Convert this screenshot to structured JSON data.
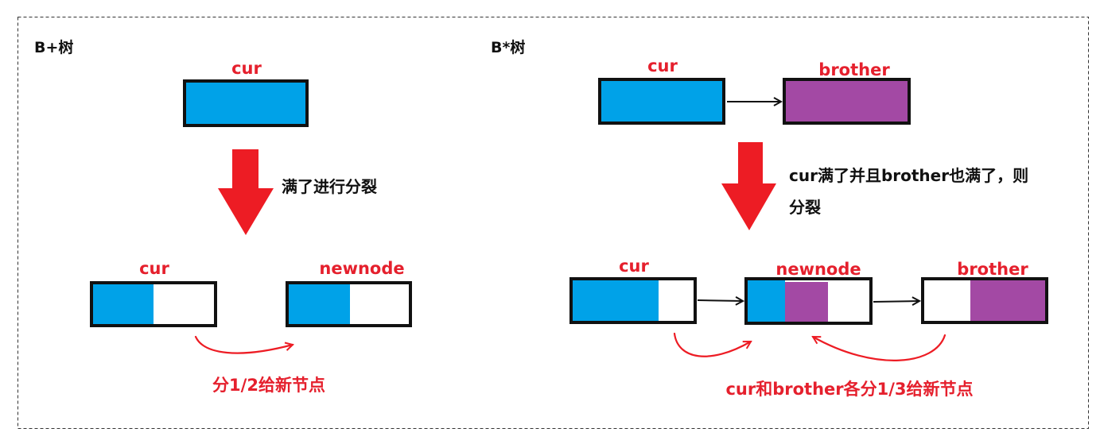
{
  "colors": {
    "cur_fill": "#00a2e8",
    "brother_fill": "#a349a4",
    "empty_fill": "#ffffff",
    "label_red": "#e5202d",
    "split_arrow": "#ed1c24",
    "border": "#111111"
  },
  "left_panel": {
    "title": "B+树",
    "top_cur_label": "cur",
    "split_caption": "满了进行分裂",
    "bottom_cur_label": "cur",
    "bottom_newnode_label": "newnode",
    "transfer_caption": "分1/2给新节点"
  },
  "right_panel": {
    "title": "B*树",
    "top_cur_label": "cur",
    "top_brother_label": "brother",
    "split_caption_line1": "cur满了并且brother也满了，则",
    "split_caption_line2": "分裂",
    "bottom_cur_label": "cur",
    "bottom_newnode_label": "newnode",
    "bottom_brother_label": "brother",
    "transfer_caption": "cur和brother各分1/3给新节点"
  }
}
